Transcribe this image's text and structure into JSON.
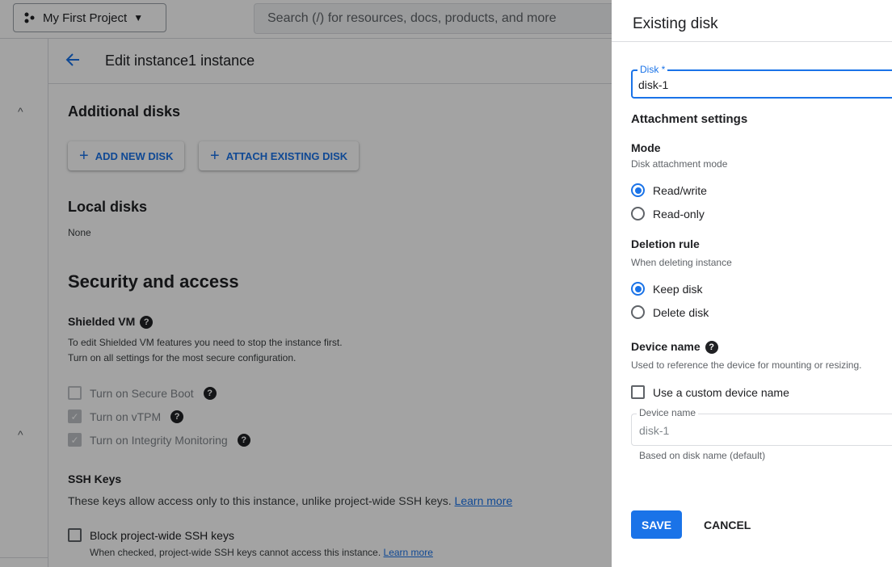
{
  "topbar": {
    "project_name": "My First Project",
    "search_placeholder": "Search (/) for resources, docs, products, and more"
  },
  "header": {
    "title": "Edit instance1 instance"
  },
  "additional_disks": {
    "title": "Additional disks",
    "add_new_label": "ADD NEW DISK",
    "attach_existing_label": "ATTACH EXISTING DISK"
  },
  "local_disks": {
    "title": "Local disks",
    "value": "None"
  },
  "security": {
    "title": "Security and access",
    "shielded_vm_title": "Shielded VM",
    "shielded_desc_1": "To edit Shielded VM features you need to stop the instance first.",
    "shielded_desc_2": "Turn on all settings for the most secure configuration.",
    "options": [
      {
        "label": "Turn on Secure Boot",
        "checked": false
      },
      {
        "label": "Turn on vTPM",
        "checked": true
      },
      {
        "label": "Turn on Integrity Monitoring",
        "checked": true
      }
    ],
    "ssh_title": "SSH Keys",
    "ssh_desc": "These keys allow access only to this instance, unlike project-wide SSH keys.",
    "learn_more": "Learn more",
    "block_label": "Block project-wide SSH keys",
    "block_desc": "When checked, project-wide SSH keys cannot access this instance."
  },
  "panel": {
    "title": "Existing disk",
    "disk_label": "Disk *",
    "disk_value": "disk-1",
    "attachment_title": "Attachment settings",
    "mode_title": "Mode",
    "mode_sub": "Disk attachment mode",
    "mode_options": [
      "Read/write",
      "Read-only"
    ],
    "mode_selected": "Read/write",
    "deletion_title": "Deletion rule",
    "deletion_sub": "When deleting instance",
    "deletion_options": [
      "Keep disk",
      "Delete disk"
    ],
    "deletion_selected": "Keep disk",
    "device_title": "Device name",
    "device_sub": "Used to reference the device for mounting or resizing.",
    "custom_device_label": "Use a custom device name",
    "device_field_label": "Device name",
    "device_field_value": "disk-1",
    "device_hint": "Based on disk name (default)",
    "save_label": "SAVE",
    "cancel_label": "CANCEL"
  },
  "colors": {
    "accent": "#1a73e8",
    "scrim": "rgba(0,0,0,0.36)"
  }
}
